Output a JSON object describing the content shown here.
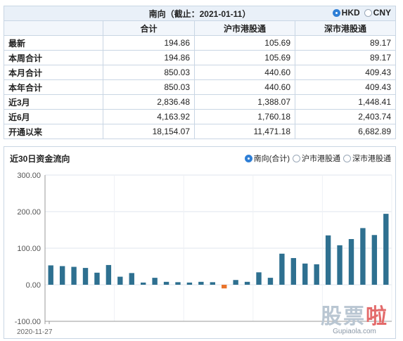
{
  "summary": {
    "title": "南向（截止：2021-01-11）",
    "currency_options": [
      {
        "label": "HKD",
        "selected": true
      },
      {
        "label": "CNY",
        "selected": false
      }
    ],
    "columns": [
      "合计",
      "沪市港股通",
      "深市港股通"
    ],
    "rows": [
      {
        "label": "最新",
        "values": [
          "194.86",
          "105.69",
          "89.17"
        ]
      },
      {
        "label": "本周合计",
        "values": [
          "194.86",
          "105.69",
          "89.17"
        ]
      },
      {
        "label": "本月合计",
        "values": [
          "850.03",
          "440.60",
          "409.43"
        ]
      },
      {
        "label": "本年合计",
        "values": [
          "850.03",
          "440.60",
          "409.43"
        ]
      },
      {
        "label": "近3月",
        "values": [
          "2,836.48",
          "1,388.07",
          "1,448.41"
        ]
      },
      {
        "label": "近6月",
        "values": [
          "4,163.92",
          "1,760.18",
          "2,403.74"
        ]
      },
      {
        "label": "开通以来",
        "values": [
          "18,154.07",
          "11,471.18",
          "6,682.89"
        ]
      }
    ]
  },
  "chart_panel": {
    "title": "近30日资金流向",
    "legend": [
      {
        "label": "南向(合计)",
        "selected": true
      },
      {
        "label": "沪市港股通",
        "selected": false
      },
      {
        "label": "深市港股通",
        "selected": false
      }
    ]
  },
  "chart_data": {
    "type": "bar",
    "ylim": [
      -100,
      300
    ],
    "y_ticks": [
      "300.00",
      "200.00",
      "100.00",
      "0.00",
      "-100.00"
    ],
    "x_tick_label": "2020-11-27",
    "grid": true,
    "positive_color": "#2e7090",
    "negative_color": "#e9742b",
    "values": [
      53,
      51,
      49,
      46,
      33,
      54,
      22,
      32,
      6,
      19,
      8,
      7,
      6,
      8,
      7,
      -10,
      13,
      8,
      34,
      19,
      85,
      73,
      58,
      56,
      135,
      108,
      125,
      155,
      136,
      194
    ]
  },
  "watermark": {
    "brand": "股票啦",
    "url": "Gupiaola.com"
  }
}
